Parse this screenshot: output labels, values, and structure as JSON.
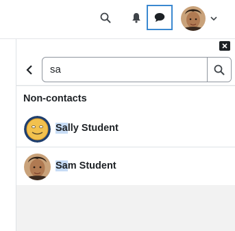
{
  "navbar": {
    "icons": [
      "search-icon",
      "bell-icon",
      "message-icon",
      "chevron-down-icon"
    ],
    "accent": "#3a88d0"
  },
  "drawer": {
    "search": {
      "value": "sa"
    },
    "section_title": "Non-contacts",
    "results": [
      {
        "match": "Sa",
        "rest": "lly Student",
        "avatar": "smiley-avatar"
      },
      {
        "match": "Sa",
        "rest": "m Student",
        "avatar": "photo-avatar"
      }
    ]
  }
}
